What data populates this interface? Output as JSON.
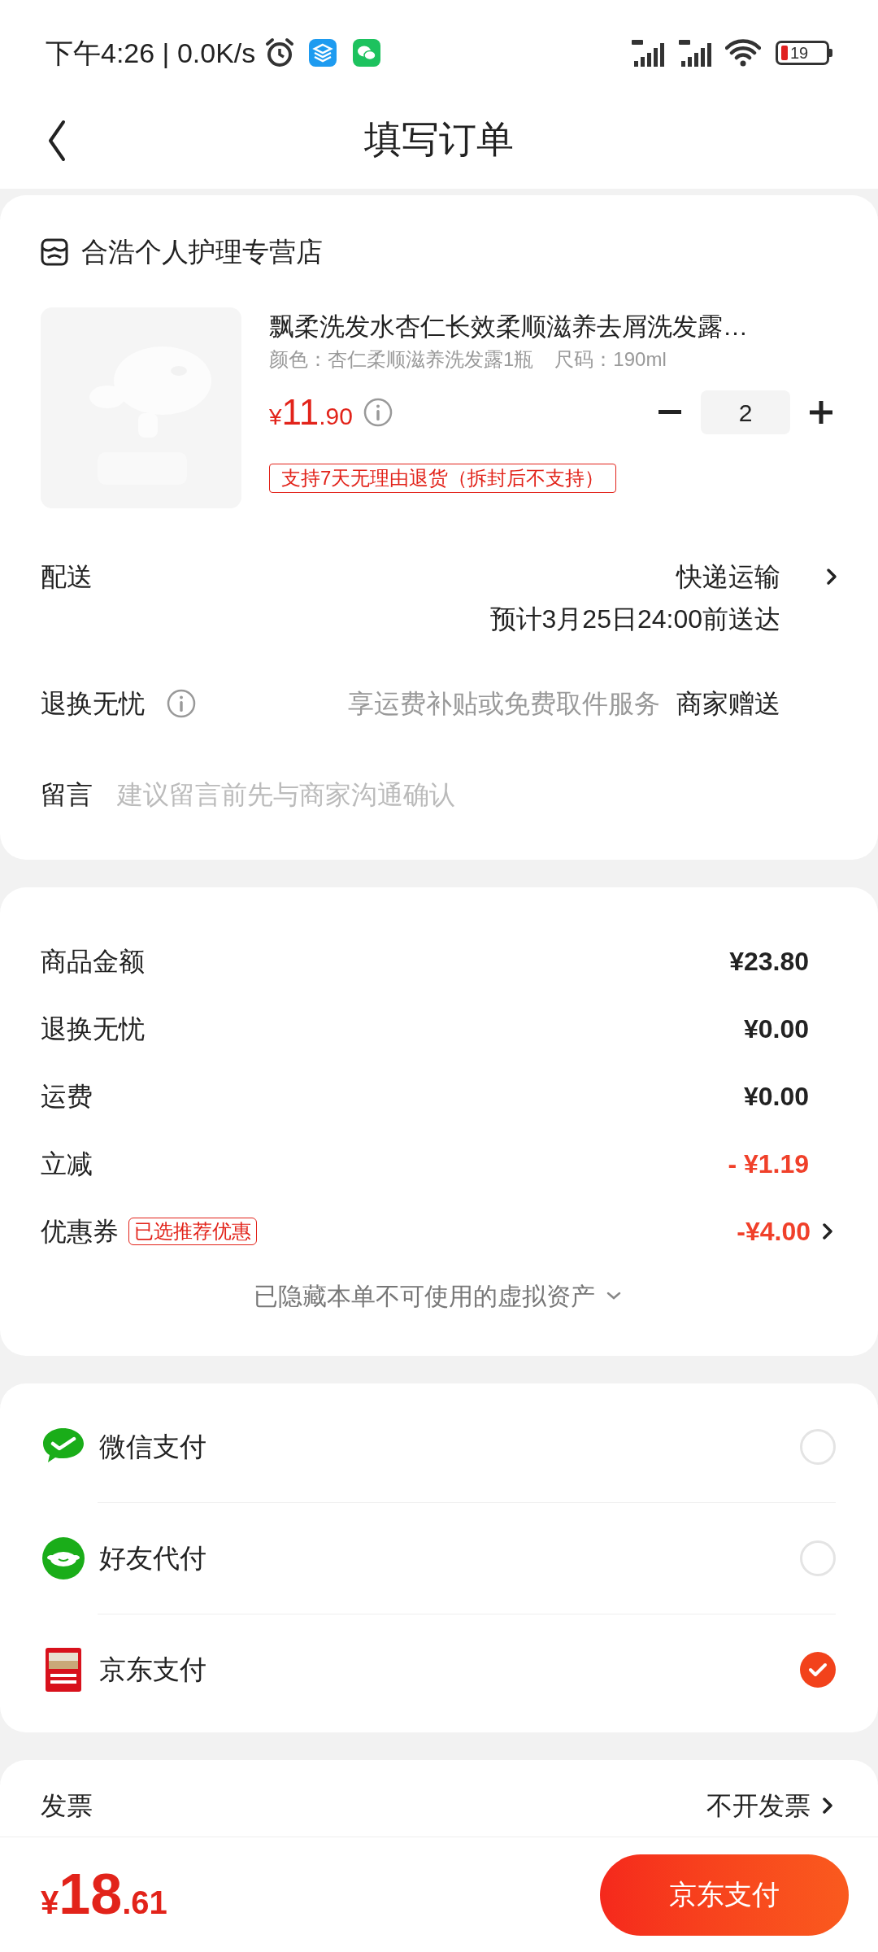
{
  "status_bar": {
    "time": "下午4:26 | 0.0K/s",
    "battery": "19"
  },
  "header": {
    "title": "填写订单"
  },
  "store": {
    "name": "合浩个人护理专营店"
  },
  "product": {
    "title": "飘柔洗发水杏仁长效柔顺滋养去屑洗发露…",
    "variant": "颜色：杏仁柔顺滋养洗发露1瓶",
    "size": "尺码：190ml",
    "currency": "¥",
    "price_int": "11",
    "price_dec": ".90",
    "quantity": "2",
    "tag": "支持7天无理由退货（拆封后不支持）"
  },
  "delivery": {
    "label": "配送",
    "method": "快递运输",
    "eta": "预计3月25日24:00前送达"
  },
  "return_service": {
    "label": "退换无忧",
    "description": "享运费补贴或免费取件服务",
    "value": "商家赠送"
  },
  "message": {
    "label": "留言",
    "placeholder": "建议留言前先与商家沟通确认"
  },
  "costs": [
    {
      "label": "商品金额",
      "value": "¥23.80",
      "kind": "normal"
    },
    {
      "label": "退换无忧",
      "value": "¥0.00",
      "kind": "normal"
    },
    {
      "label": "运费",
      "value": "¥0.00",
      "kind": "normal"
    },
    {
      "label": "立减",
      "value": "- ¥1.19",
      "kind": "discount"
    },
    {
      "label": "优惠券",
      "badge": "已选推荐优惠",
      "value": "-¥4.00",
      "kind": "coupon"
    }
  ],
  "hidden_assets": "已隐藏本单不可使用的虚拟资产",
  "payment_methods": [
    {
      "name": "微信支付",
      "kind": "wechat",
      "selected": false
    },
    {
      "name": "好友代付",
      "kind": "friend",
      "selected": false
    },
    {
      "name": "京东支付",
      "kind": "jdpay",
      "selected": true
    }
  ],
  "invoice": {
    "label": "发票",
    "value": "不开发票"
  },
  "bottom_bar": {
    "currency": "¥",
    "amount_int": "18",
    "amount_dec": ".61",
    "button": "京东支付"
  }
}
